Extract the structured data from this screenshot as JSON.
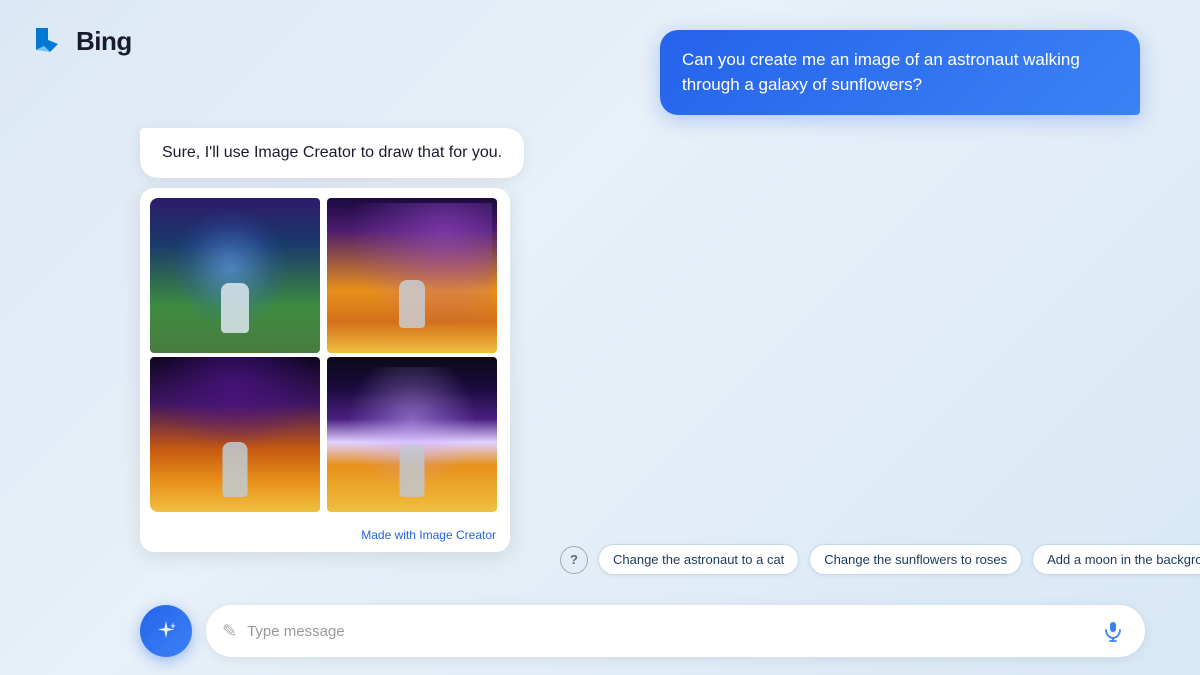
{
  "header": {
    "logo_alt": "Bing logo",
    "title": "Bing"
  },
  "user_message": {
    "text": "Can you create me an image of an astronaut walking through a galaxy of sunflowers?"
  },
  "bot_response": {
    "text": "Sure, I'll use Image Creator to draw that for you."
  },
  "image_grid": {
    "made_with_prefix": "Made with ",
    "made_with_link": "Image Creator"
  },
  "suggestions": {
    "help_label": "?",
    "chips": [
      {
        "id": "chip-cat",
        "label": "Change the astronaut to a cat"
      },
      {
        "id": "chip-roses",
        "label": "Change the sunflowers to roses"
      },
      {
        "id": "chip-moon",
        "label": "Add a moon in the background"
      }
    ]
  },
  "input": {
    "placeholder": "Type message"
  }
}
